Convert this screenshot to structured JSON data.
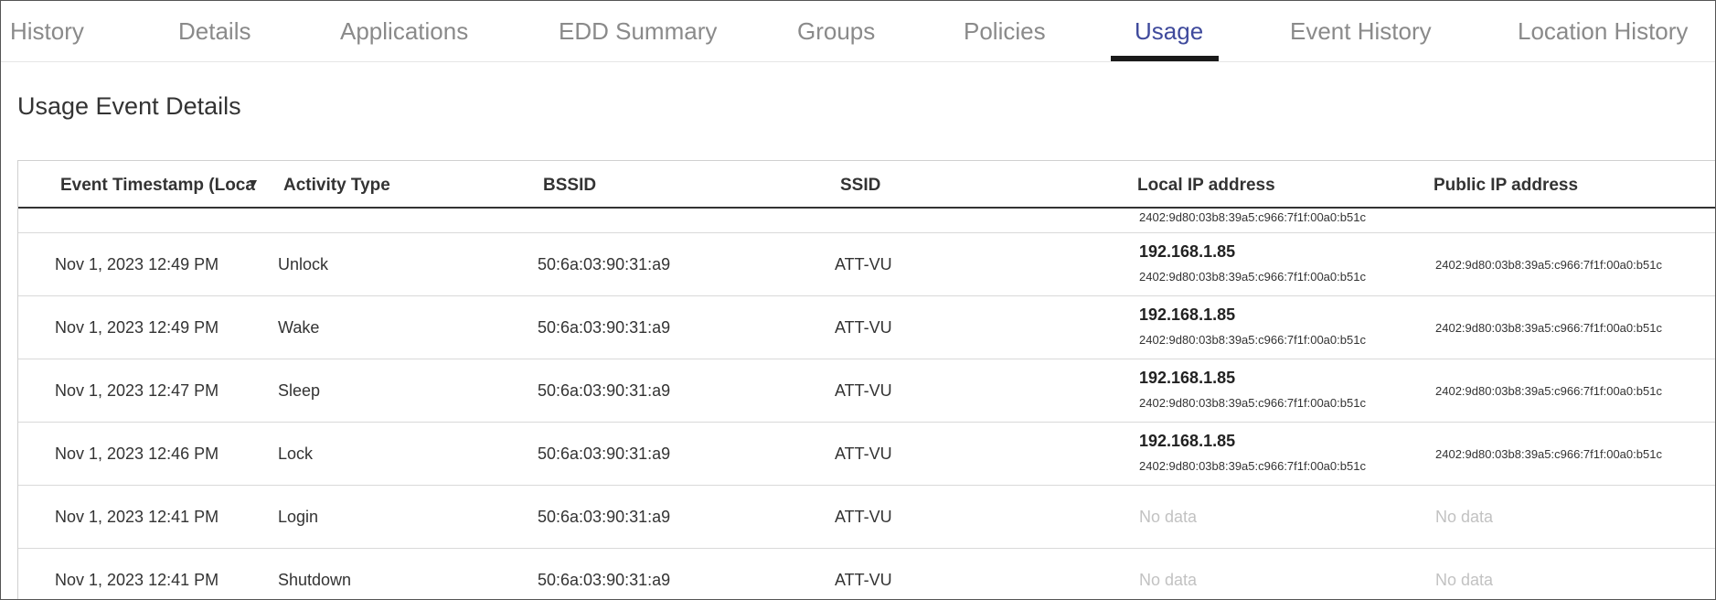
{
  "tabs": [
    {
      "label": "History",
      "active": false
    },
    {
      "label": "Details",
      "active": false
    },
    {
      "label": "Applications",
      "active": false
    },
    {
      "label": "EDD Summary",
      "active": false
    },
    {
      "label": "Groups",
      "active": false
    },
    {
      "label": "Policies",
      "active": false
    },
    {
      "label": "Usage",
      "active": true
    },
    {
      "label": "Event History",
      "active": false
    },
    {
      "label": "Location History",
      "active": false
    }
  ],
  "page_title": "Usage Event Details",
  "table": {
    "columns": [
      "Event Timestamp (Loca",
      "Activity Type",
      "BSSID",
      "SSID",
      "Local IP address",
      "Public IP address"
    ],
    "sort_icon": "sort-desc-icon",
    "partial_row_local_ip": "2402:9d80:03b8:39a5:c966:7f1f:00a0:b51c",
    "rows": [
      {
        "timestamp": "Nov 1, 2023 12:49 PM",
        "activity": "Unlock",
        "bssid": "50:6a:03:90:31:a9",
        "ssid": "ATT-VU",
        "local_ip": "192.168.1.85",
        "local_ipv6": "2402:9d80:03b8:39a5:c966:7f1f:00a0:b51c",
        "public_ip": "2402:9d80:03b8:39a5:c966:7f1f:00a0:b51c"
      },
      {
        "timestamp": "Nov 1, 2023 12:49 PM",
        "activity": "Wake",
        "bssid": "50:6a:03:90:31:a9",
        "ssid": "ATT-VU",
        "local_ip": "192.168.1.85",
        "local_ipv6": "2402:9d80:03b8:39a5:c966:7f1f:00a0:b51c",
        "public_ip": "2402:9d80:03b8:39a5:c966:7f1f:00a0:b51c"
      },
      {
        "timestamp": "Nov 1, 2023 12:47 PM",
        "activity": "Sleep",
        "bssid": "50:6a:03:90:31:a9",
        "ssid": "ATT-VU",
        "local_ip": "192.168.1.85",
        "local_ipv6": "2402:9d80:03b8:39a5:c966:7f1f:00a0:b51c",
        "public_ip": "2402:9d80:03b8:39a5:c966:7f1f:00a0:b51c"
      },
      {
        "timestamp": "Nov 1, 2023 12:46 PM",
        "activity": "Lock",
        "bssid": "50:6a:03:90:31:a9",
        "ssid": "ATT-VU",
        "local_ip": "192.168.1.85",
        "local_ipv6": "2402:9d80:03b8:39a5:c966:7f1f:00a0:b51c",
        "public_ip": "2402:9d80:03b8:39a5:c966:7f1f:00a0:b51c"
      },
      {
        "timestamp": "Nov 1, 2023 12:41 PM",
        "activity": "Login",
        "bssid": "50:6a:03:90:31:a9",
        "ssid": "ATT-VU",
        "local_ip_nodata": "No data",
        "public_ip_nodata": "No data"
      },
      {
        "timestamp": "Nov 1, 2023 12:41 PM",
        "activity": "Shutdown",
        "bssid": "50:6a:03:90:31:a9",
        "ssid": "ATT-VU",
        "local_ip_nodata": "No data",
        "public_ip_nodata": "No data"
      }
    ]
  }
}
